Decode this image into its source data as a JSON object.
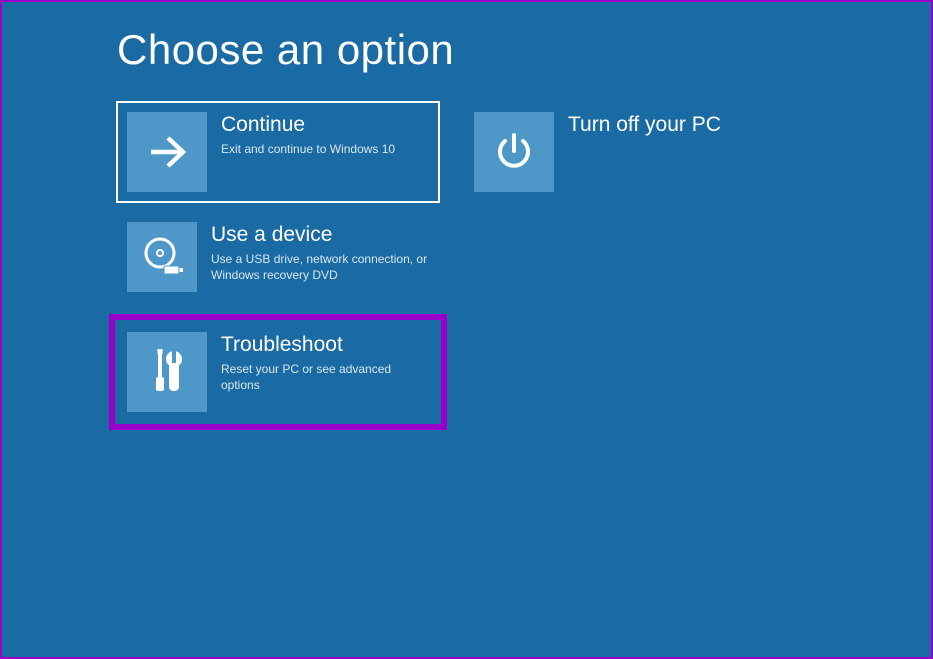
{
  "page": {
    "title": "Choose an option"
  },
  "options": {
    "continue": {
      "title": "Continue",
      "desc": "Exit and continue to Windows 10"
    },
    "turnoff": {
      "title": "Turn off your PC"
    },
    "use_device": {
      "title": "Use a device",
      "desc": "Use a USB drive, network connection, or Windows recovery DVD"
    },
    "troubleshoot": {
      "title": "Troubleshoot",
      "desc": "Reset your PC or see advanced options"
    }
  }
}
